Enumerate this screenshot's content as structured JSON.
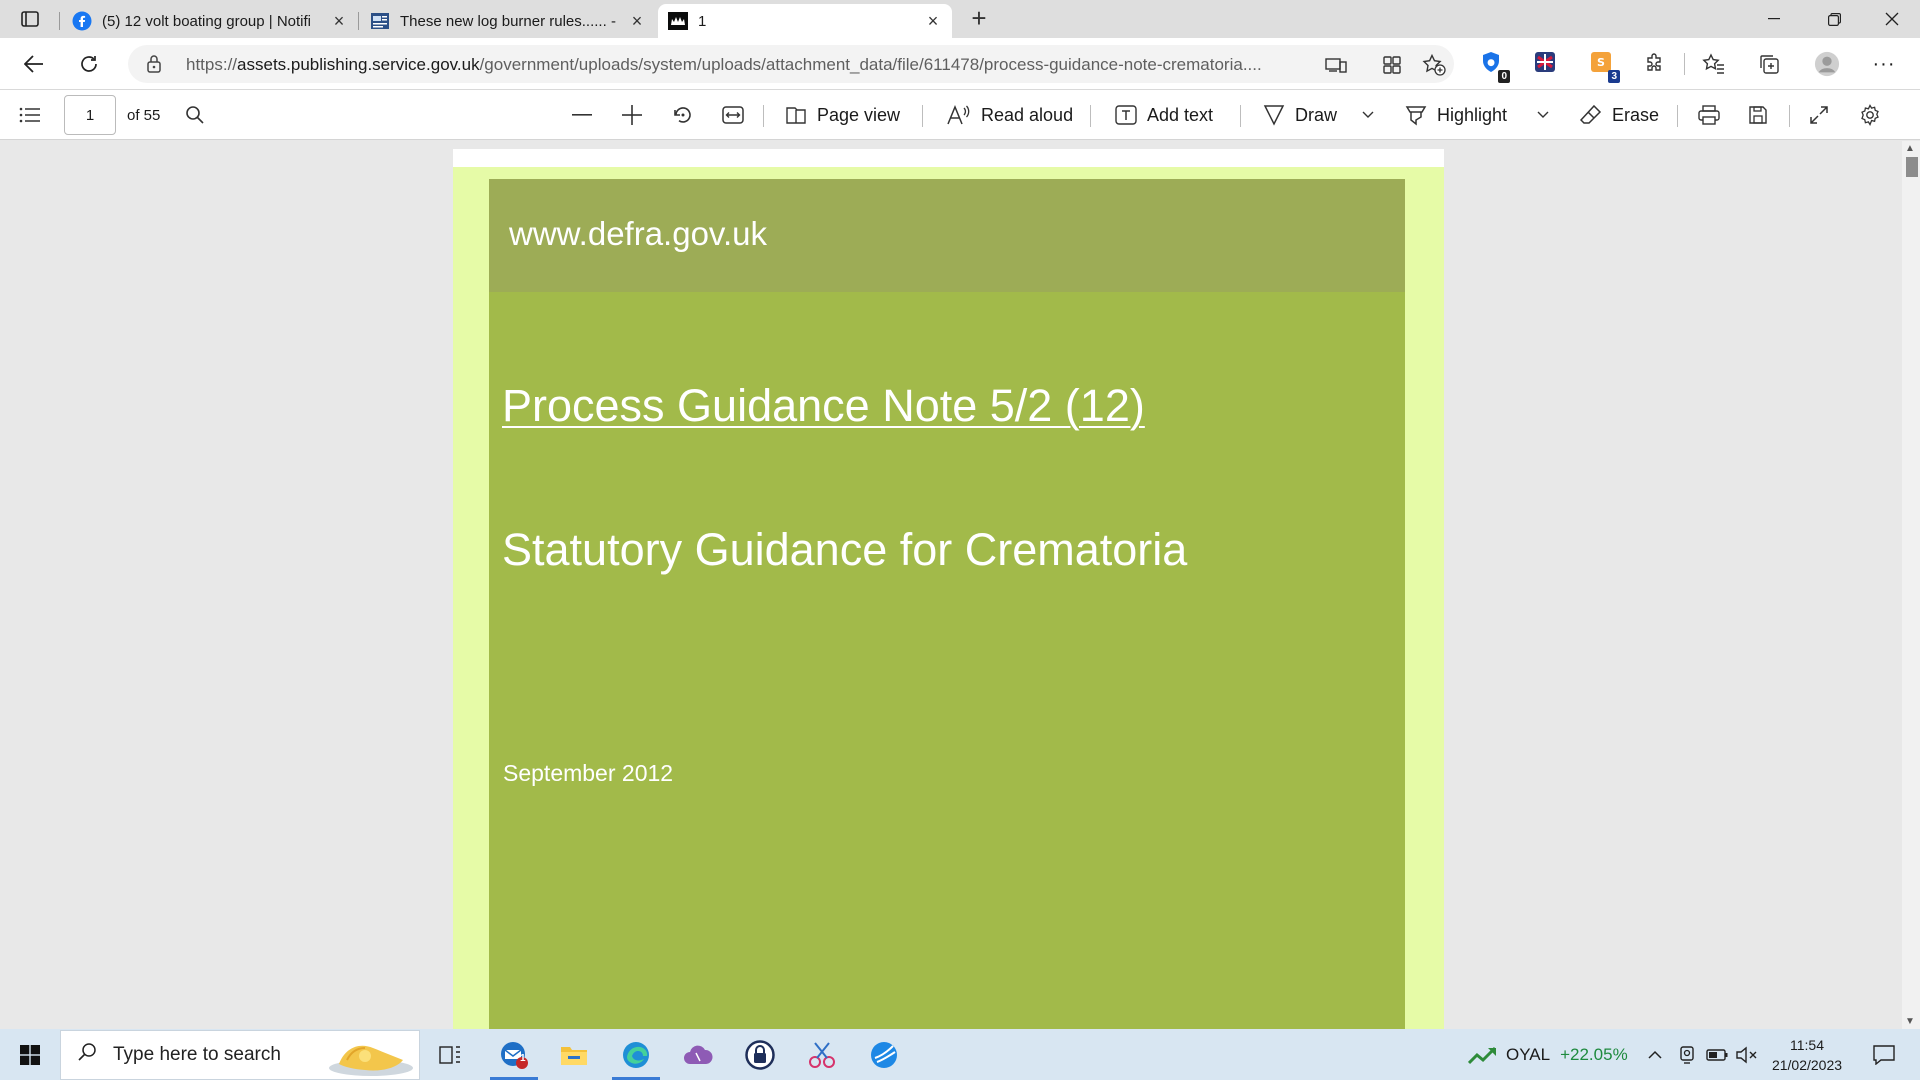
{
  "browser": {
    "tabs": [
      {
        "title": "(5) 12 volt boating group | Notifi",
        "icon": "facebook-icon",
        "active": false
      },
      {
        "title": "These new log burner rules...... -",
        "icon": "news-icon",
        "active": false
      },
      {
        "title": "1",
        "icon": "gov-crown-icon",
        "active": true
      }
    ],
    "url_prefix": "https://",
    "url_host": "assets.publishing.service.gov.uk",
    "url_path": "/government/uploads/system/uploads/attachment_data/file/611478/process-guidance-note-crematoria....",
    "extensions": [
      {
        "icon": "extension-1-icon",
        "badge": "0"
      },
      {
        "icon": "extension-2-icon",
        "badge": ""
      },
      {
        "icon": "extension-3-icon",
        "badge": "3"
      }
    ]
  },
  "pdf_toolbar": {
    "page_current": "1",
    "page_total": "of 55",
    "page_view": "Page view",
    "read_aloud": "Read aloud",
    "add_text": "Add text",
    "draw": "Draw",
    "highlight": "Highlight",
    "erase": "Erase"
  },
  "document": {
    "header_url": "www.defra.gov.uk",
    "title": "Process Guidance Note 5/2 (12)",
    "subtitle": "Statutory Guidance for Crematoria",
    "date": "September 2012",
    "colors": {
      "outer": "#e6fba7",
      "header": "#9dac56",
      "body": "#a2ba4a"
    }
  },
  "taskbar": {
    "search_placeholder": "Type here to search",
    "stock_symbol": "OYAL",
    "stock_change": "+22.05%",
    "time": "11:54",
    "date": "21/02/2023",
    "mail_badge": "1"
  }
}
